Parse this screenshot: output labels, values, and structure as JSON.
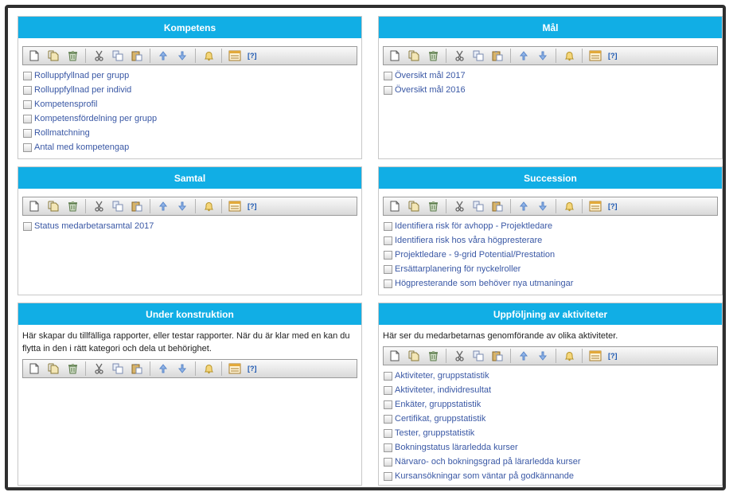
{
  "toolbar": {
    "icons": [
      "new-document-icon",
      "copy-document-icon",
      "trash-icon",
      "cut-icon",
      "copy-icon",
      "paste-icon",
      "arrow-up-icon",
      "arrow-down-icon",
      "bell-icon",
      "report-settings-icon"
    ],
    "help_label": "[?]"
  },
  "panels": [
    {
      "title": "Kompetens",
      "items": [
        "Rolluppfyllnad per grupp",
        "Rolluppfyllnad per individ",
        "Kompetensprofil",
        "Kompetensfördelning per grupp",
        "Rollmatchning",
        "Antal med kompetengap"
      ]
    },
    {
      "title": "Mål",
      "items": [
        "Översikt mål 2017",
        "Översikt mål 2016"
      ]
    },
    {
      "title": "Samtal",
      "items": [
        "Status medarbetarsamtal 2017"
      ]
    },
    {
      "title": "Succession",
      "items": [
        "Identifiera risk för avhopp - Projektledare",
        "Identifiera risk hos våra högpresterare",
        "Projektledare - 9-grid Potential/Prestation",
        "Ersättarplanering för nyckelroller",
        "Högpresterande som behöver nya utmaningar"
      ]
    },
    {
      "title": "Under konstruktion",
      "description": "Här skapar du tillfälliga rapporter, eller testar rapporter. När du är klar med en kan du flytta in den i rätt kategori och dela ut behörighet.",
      "items": []
    },
    {
      "title": "Uppföljning av aktiviteter",
      "description": "Här ser du medarbetarnas genomförande av olika aktiviteter.",
      "items": [
        "Aktiviteter, gruppstatistik",
        "Aktiviteter, individresultat",
        "Enkäter, gruppstatistik",
        "Certifikat, gruppstatistik",
        "Tester, gruppstatistik",
        "Bokningstatus lärarledda kurser",
        "Närvaro- och bokningsgrad på lärarledda kurser",
        "Kursansökningar som väntar på godkännande"
      ]
    }
  ]
}
